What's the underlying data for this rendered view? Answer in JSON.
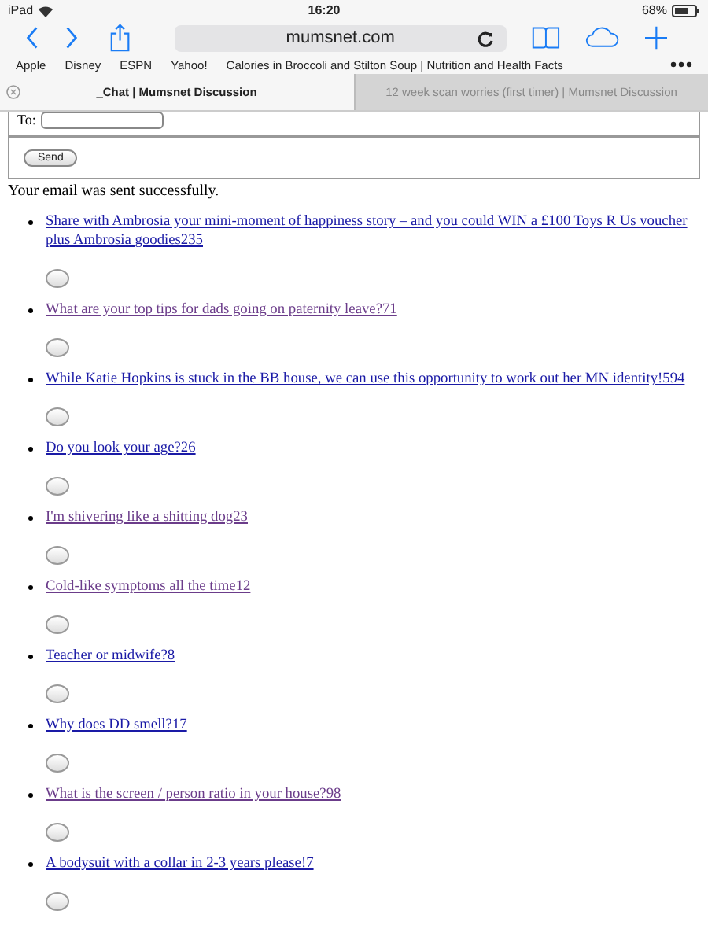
{
  "status_bar": {
    "device": "iPad",
    "time": "16:20",
    "battery": "68%"
  },
  "toolbar": {
    "address": "mumsnet.com"
  },
  "bookmarks": [
    "Apple",
    "Disney",
    "ESPN",
    "Yahoo!",
    "Calories in Broccoli and Stilton Soup | Nutrition and Health Facts"
  ],
  "tabs": [
    {
      "title": "_Chat | Mumsnet Discussion",
      "selected": true
    },
    {
      "title": "12 week scan worries (first timer) | Mumsnet Discussion",
      "selected": false
    }
  ],
  "form": {
    "to_label": "To:",
    "send_button": "Send"
  },
  "message": "Your email was sent successfully.",
  "threads": [
    {
      "title": "Share with Ambrosia your mini-moment of happiness story – and you could WIN a £100 Toys R Us voucher plus Ambrosia goodies235",
      "visited": false
    },
    {
      "title": "What are your top tips for dads going on paternity leave?71",
      "visited": true
    },
    {
      "title": "While Katie Hopkins is stuck in the BB house, we can use this opportunity to work out her MN identity!594",
      "visited": false
    },
    {
      "title": "Do you look your age?26",
      "visited": false
    },
    {
      "title": "I'm shivering like a shitting dog23",
      "visited": true
    },
    {
      "title": "Cold-like symptoms all the time12",
      "visited": true
    },
    {
      "title": "Teacher or midwife?8",
      "visited": false
    },
    {
      "title": "Why does DD smell?17",
      "visited": false
    },
    {
      "title": "What is the screen / person ratio in your house?98",
      "visited": true
    },
    {
      "title": "A bodysuit with a collar in 2-3 years please!7",
      "visited": false
    }
  ]
}
